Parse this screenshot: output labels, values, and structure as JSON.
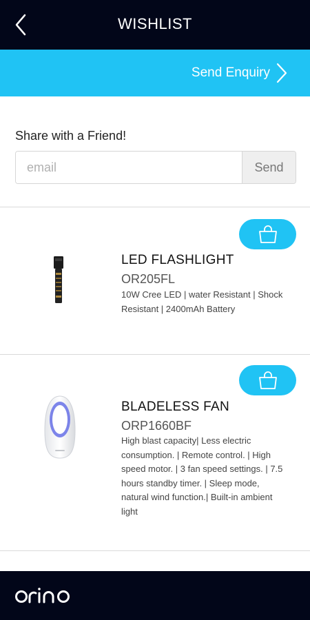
{
  "header": {
    "title": "WISHLIST",
    "back_icon": "chevron-left-icon"
  },
  "enquiry": {
    "label": "Send Enquiry",
    "icon": "chevron-right-icon"
  },
  "share": {
    "label": "Share with a Friend!",
    "email_placeholder": "email",
    "email_value": "",
    "send_label": "Send"
  },
  "products": [
    {
      "name": "LED FLASHLIGHT",
      "code": "OR205FL",
      "description": "10W Cree LED | water Resistant | Shock Resistant | 2400mAh Battery",
      "image": "flashlight-image",
      "cart_icon": "shopping-bag-icon"
    },
    {
      "name": "BLADELESS FAN",
      "code": "ORP1660BF",
      "description": "High blast capacity| Less electric consumption. | Remote control. | High speed motor. | 3 fan speed settings. | 7.5 hours standby timer. | Sleep mode, natural wind function.| Built-in ambient light",
      "image": "bladeless-fan-image",
      "cart_icon": "shopping-bag-icon"
    }
  ],
  "footer": {
    "logo": "orino"
  },
  "colors": {
    "dark": "#020619",
    "accent": "#20c3f4"
  }
}
